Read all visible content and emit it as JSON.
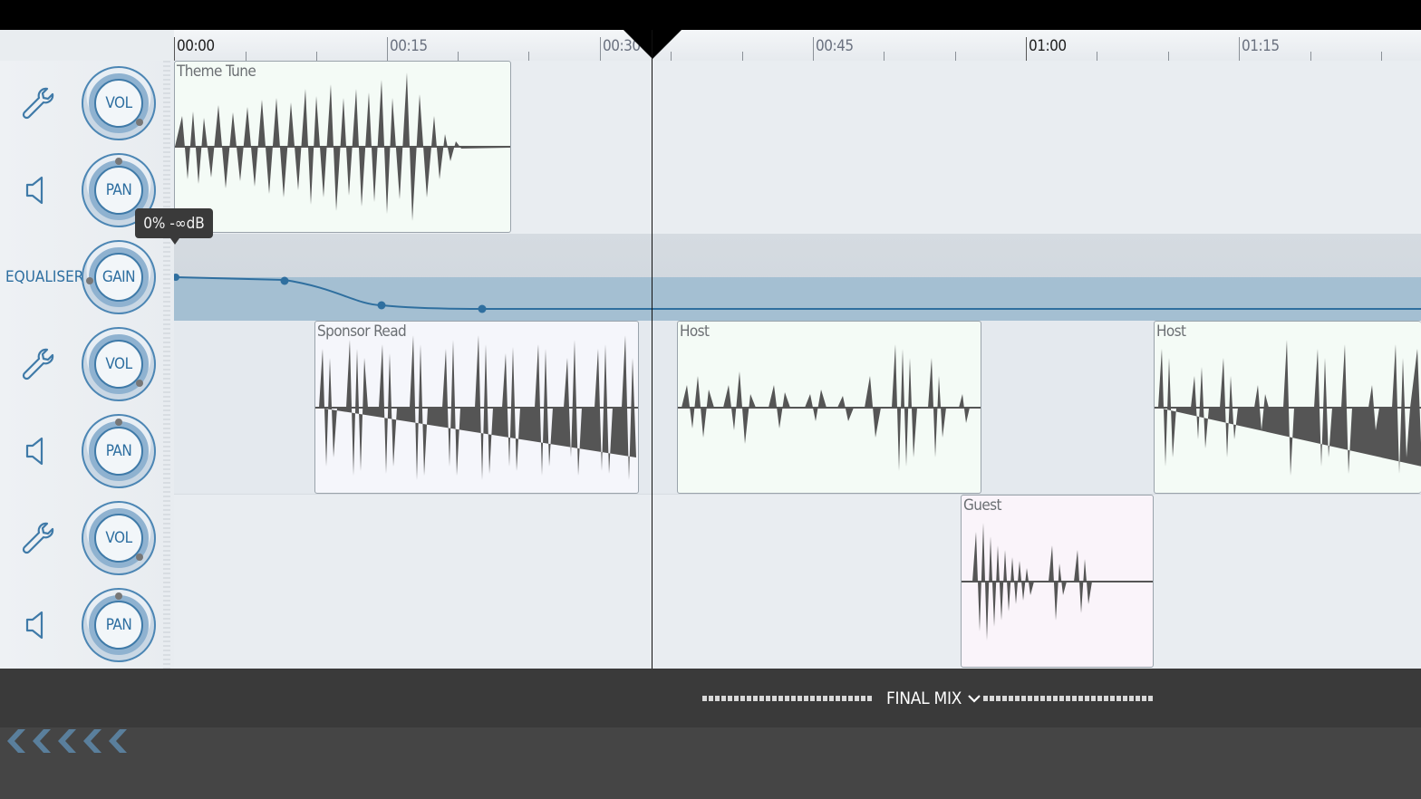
{
  "ruler": {
    "labels": [
      "00:00",
      "00:15",
      "00:30",
      "00:45",
      "01:00",
      "01:15"
    ]
  },
  "tracks": [
    {
      "controls": [
        "VOL",
        "PAN"
      ],
      "clips": [
        {
          "name": "Theme Tune",
          "color": "green"
        }
      ]
    },
    {
      "controls": [
        "VOL",
        "PAN"
      ],
      "clips": [
        {
          "name": "Sponsor Read",
          "color": "blue"
        },
        {
          "name": "Host",
          "color": "green"
        },
        {
          "name": "Host",
          "color": "green"
        }
      ]
    },
    {
      "controls": [
        "VOL",
        "PAN"
      ],
      "clips": [
        {
          "name": "Guest",
          "color": "pink"
        }
      ]
    }
  ],
  "equaliser": {
    "label": "EQUALISER",
    "knob": "GAIN",
    "tooltip": "0% -∞dB"
  },
  "footer": {
    "mix_label": "FINAL MIX"
  },
  "colors": {
    "accent": "#2d6ea0",
    "clip_green": "#f4fbf6",
    "clip_blue": "#f5f6fb",
    "clip_pink": "#faf4fa",
    "waveform": "#555555"
  },
  "icons": [
    "wrench-icon",
    "speaker-icon",
    "chevron-down-icon",
    "rewind-chevrons-icon"
  ]
}
